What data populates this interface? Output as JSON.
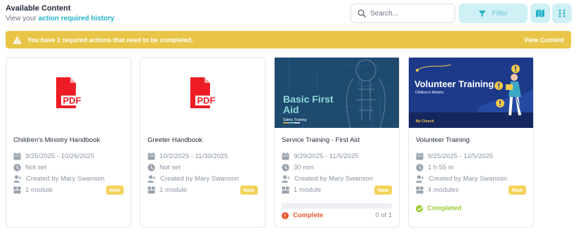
{
  "header": {
    "title": "Available Content",
    "subtitle_prefix": "View your ",
    "subtitle_link": "action required history"
  },
  "search": {
    "placeholder": "Search..."
  },
  "filter": {
    "label": "Filter"
  },
  "banner": {
    "message": "You have 1 required actions that need to be completed.",
    "action": "View Content"
  },
  "cards": [
    {
      "title": "Children's Ministry Handbook",
      "dates": "9/25/2025 - 10/26/2025",
      "duration": "Not set",
      "created_by": "Created by Mary Swanson",
      "modules": "1 module",
      "badge": "New",
      "thumb_label": "PDF"
    },
    {
      "title": "Greeter Handbook",
      "dates": "10/2/2025 - 11/30/2025",
      "duration": "Not set",
      "created_by": "Created by Mary Swanson",
      "modules": "1 module",
      "badge": "New",
      "thumb_label": "PDF"
    },
    {
      "title": "Service Training - First Aid",
      "dates": "9/29/2025 - 11/5/2025",
      "duration": "30 min",
      "created_by": "Created by Mary Swanson",
      "modules": "1 module",
      "badge": "New",
      "thumb_title_1": "Basic First",
      "thumb_title_2": "Aid",
      "thumb_subtitle": "Safety Training",
      "progress": 0,
      "status": "Complete",
      "status_color": "#e4572e",
      "count": "0 of 1"
    },
    {
      "title": "Volunteer Training",
      "dates": "9/25/2025 - 12/5/2025",
      "duration": "1 h 55 m",
      "created_by": "Created by Mary Swanson",
      "modules": "4 modules",
      "badge": "New",
      "thumb_title": "Volunteer Training",
      "thumb_subtitle": "Children's Ministry",
      "thumb_footer": "My Church",
      "status": "Completed",
      "status_color": "#9acd32"
    }
  ],
  "colors": {
    "accent": "#22b3c7",
    "banner": "#e8c547",
    "badge": "#f3d35c",
    "pdf_red": "#ee1c24"
  },
  "icons": [
    "search-icon",
    "filter-icon",
    "map-icon",
    "grid-icon",
    "warning-icon",
    "calendar-icon",
    "clock-icon",
    "user-add-icon",
    "modules-icon"
  ]
}
